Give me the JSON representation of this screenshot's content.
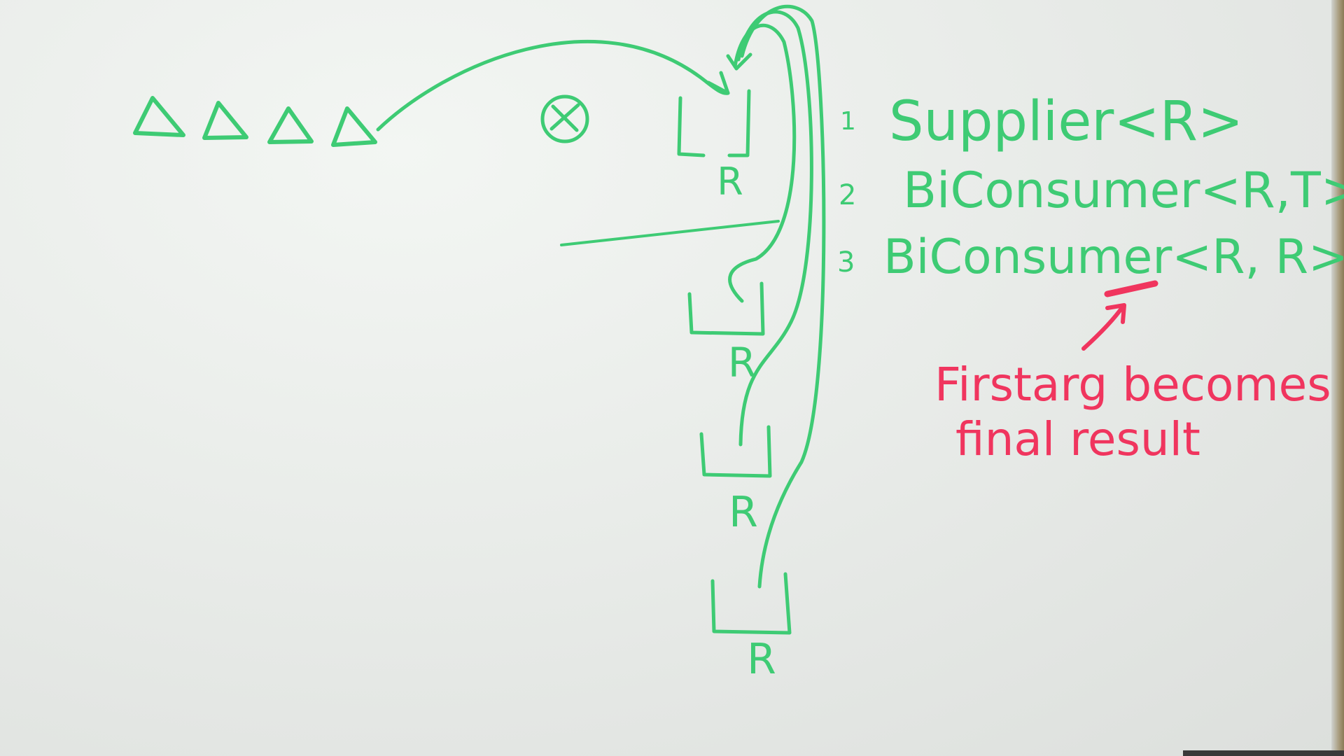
{
  "diagram": {
    "signatures": [
      {
        "number": "1",
        "text": "Supplier<R>"
      },
      {
        "number": "2",
        "text": "BiConsumer<R,T>"
      },
      {
        "number": "3",
        "text": "BiConsumer<R, R>"
      }
    ],
    "container_label": "R",
    "annotation": {
      "line1": "Firstarg becomes",
      "line2": "final result"
    },
    "colors": {
      "marker_green": "#3ecb74",
      "marker_red": "#f0355e",
      "board": "#e9ece9"
    }
  }
}
